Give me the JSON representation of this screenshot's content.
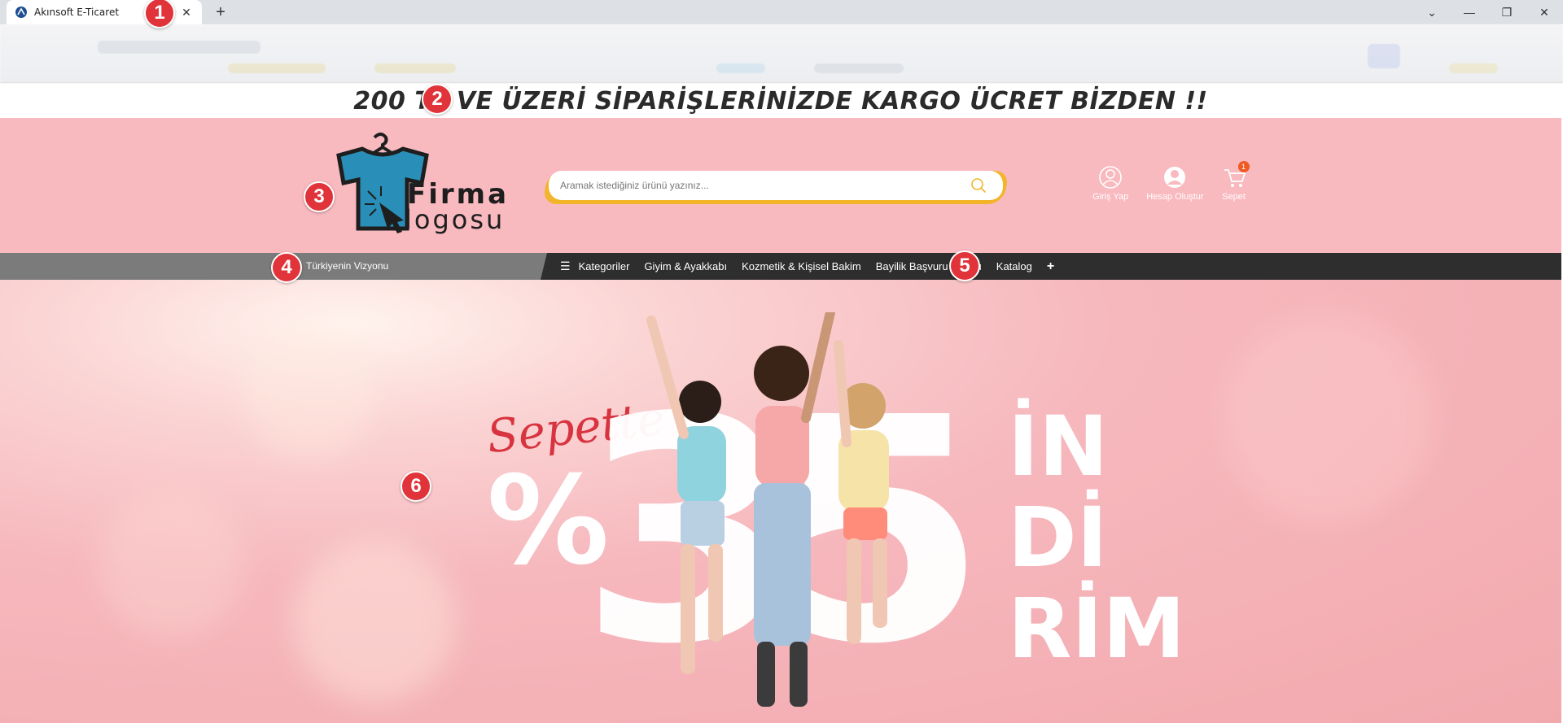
{
  "browser": {
    "tab_title": "Akınsoft E-Ticaret",
    "close_symbol": "✕",
    "new_tab_symbol": "+",
    "controls": {
      "dropdown": "⌄",
      "minimize": "—",
      "restore": "❐",
      "close": "✕"
    }
  },
  "annotations": [
    "1",
    "2",
    "3",
    "4",
    "5",
    "6"
  ],
  "announcement": {
    "text": "200 TL VE ÜZERİ SİPARİŞLERİNİZDE KARGO ÜCRET BİZDEN !!"
  },
  "header": {
    "logo": {
      "firma": "Firma",
      "logosu": "logosu"
    },
    "search": {
      "placeholder": "Aramak istediğiniz ürünü yazınız..."
    },
    "user_links": {
      "login": "Giriş Yap",
      "register": "Hesap Oluştur",
      "cart": "Sepet",
      "cart_count": "1"
    },
    "colors": {
      "header_bg": "#f8b9bf",
      "search_accent": "#f2b52a",
      "cart_badge": "#f05a22"
    }
  },
  "nav": {
    "left_text": "Türkiyenin Vizyonu",
    "items": [
      {
        "label": "Kategoriler",
        "icon": "menu-icon"
      },
      {
        "label": "Giyim & Ayakkabı"
      },
      {
        "label": "Kozmetik & Kişisel Bakim"
      },
      {
        "label": "Bayilik Başvuru Formu"
      },
      {
        "label": "Katalog"
      },
      {
        "label": "+",
        "icon": "plus-icon"
      }
    ]
  },
  "hero": {
    "sepette": "Sepette",
    "percent": "%",
    "number": "35",
    "indirim_lines": [
      "İN",
      "Dİ",
      "RİM"
    ]
  }
}
